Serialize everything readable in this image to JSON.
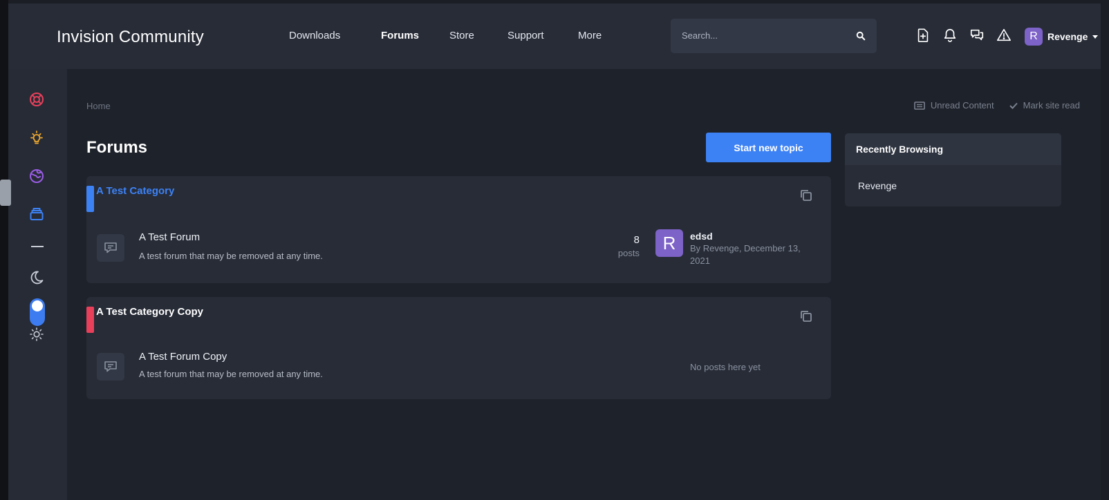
{
  "header": {
    "logo": "Invision Community",
    "nav": [
      {
        "label": "Downloads",
        "active": false
      },
      {
        "label": "Forums",
        "active": true
      },
      {
        "label": "Store",
        "active": false
      },
      {
        "label": "Support",
        "active": false
      },
      {
        "label": "More",
        "active": false
      }
    ],
    "search_placeholder": "Search...",
    "icons": [
      "new-content-icon",
      "bell-icon",
      "messages-icon",
      "warning-icon"
    ],
    "user": {
      "initial": "R",
      "name": "Revenge",
      "avatar_color": "#7d62c7"
    }
  },
  "sidebar": {
    "icons": [
      "lifebuoy-icon",
      "lightbulb-icon",
      "globe-icon",
      "archive-icon"
    ],
    "theme_icons": [
      "moon-icon",
      "sun-icon"
    ]
  },
  "main": {
    "breadcrumb": "Home",
    "unread_content": "Unread Content",
    "mark_site_read": "Mark site read",
    "page_title": "Forums",
    "start_new_topic": "Start new topic"
  },
  "categories": [
    {
      "title": "A Test Category",
      "color": "#3d82f5",
      "forum": {
        "title": "A Test Forum",
        "description": "A test forum that may be removed at any time.",
        "posts": "8",
        "posts_label": "posts",
        "last_post": {
          "initial": "R",
          "title": "edsd",
          "meta": "By Revenge, December 13, 2021"
        }
      }
    },
    {
      "title": "A Test Category Copy",
      "color": "#e8405b",
      "forum": {
        "title": "A Test Forum Copy",
        "description": "A test forum that may be removed at any time.",
        "empty_text": "No posts here yet"
      }
    }
  ],
  "widget": {
    "title": "Recently Browsing",
    "users": [
      "Revenge"
    ]
  },
  "colors": {
    "accent": "#3d82f5",
    "category_1": "#3d82f5",
    "category_2": "#e8405b",
    "avatar": "#7d62c7"
  }
}
